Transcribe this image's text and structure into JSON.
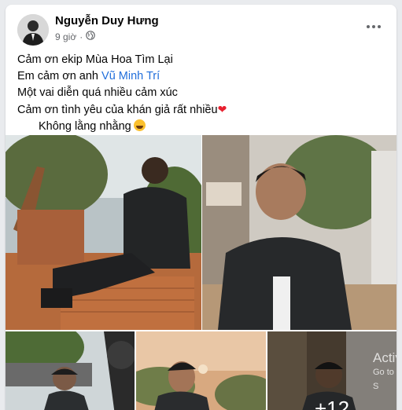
{
  "post": {
    "author": "Nguyễn Duy Hưng",
    "time": "9 giờ",
    "privacy_icon": "globe-icon",
    "more_icon": "more-horizontal-icon",
    "lines": {
      "l1": "Cảm ơn ekip Mùa Hoa Tìm Lại",
      "l2_prefix": "Em cảm ơn anh ",
      "l2_link": "Vũ Minh Trí",
      "l3": "Một vai diễn quá  nhiều cảm xúc",
      "l4": "Cảm ơn tình yêu của khán giả rất nhiều",
      "l5": "Không lằng nhằng"
    },
    "emojis": {
      "heart": "❤",
      "laugh": "laughing-face-emoji"
    }
  },
  "photos": {
    "more_count": "+12"
  },
  "watermark": {
    "line1": "Activ",
    "line2": "Go to S"
  },
  "colors": {
    "link": "#216fdb",
    "text": "#050505",
    "secondary": "#65676b",
    "heart": "#e8202f"
  }
}
